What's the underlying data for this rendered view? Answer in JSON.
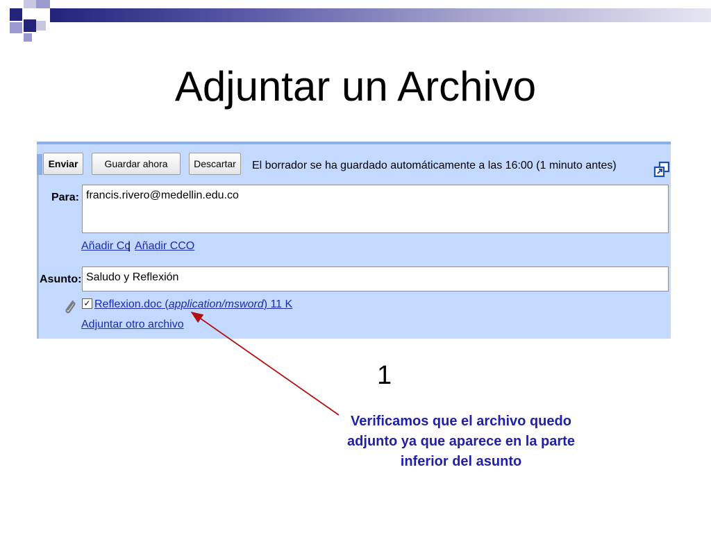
{
  "slide": {
    "title": "Adjuntar un Archivo"
  },
  "colors": {
    "accent_dark": "#23237a",
    "accent_light": "#9a9ad0",
    "compose_bg": "#c3d9ff",
    "link": "#1a2ab4",
    "arrow": "#b01010",
    "caption": "#1f1fa8"
  },
  "compose": {
    "buttons": {
      "send": "Enviar",
      "save_now": "Guardar ahora",
      "discard": "Descartar"
    },
    "status": "El borrador se ha guardado automáticamente a las 16:00 (1 minuto antes)",
    "to_label": "Para:",
    "to_value": "francis.rivero@medellin.edu.co",
    "add_cc": "Añadir Cc",
    "separator": "|",
    "add_bcc": "Añadir CCO",
    "subject_label": "Asunto:",
    "subject_value": "Saludo y Reflexión",
    "attachment": {
      "name": "Reflexion.doc",
      "open_paren": " (",
      "mime": "application/msword",
      "close_size": ") 11 K",
      "checked": true
    },
    "attach_another": "Adjuntar otro archivo",
    "icons": {
      "popout": "popout-window-icon",
      "attachment": "paperclip-icon",
      "checkbox": "checkbox-checked-icon"
    }
  },
  "annotation": {
    "step_number": "1",
    "caption": "Verificamos que el archivo quedo adjunto ya que aparece en la parte inferior del asunto"
  }
}
